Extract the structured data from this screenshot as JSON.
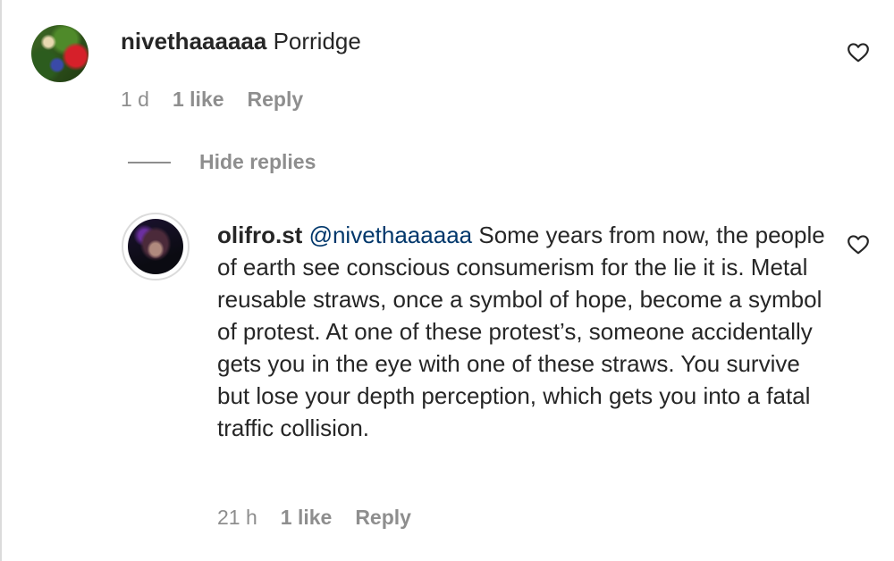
{
  "comment": {
    "username": "nivethaaaaaa",
    "text": "Porridge",
    "time": "1 d",
    "likes": "1 like",
    "reply_label": "Reply",
    "heart_icon": "heart-outline-icon"
  },
  "hide_replies_label": "Hide replies",
  "reply": {
    "username": "olifro.st",
    "mention": "@nivethaaaaaa",
    "text": "Some years from now, the people of earth see conscious consumerism for the lie it is. Metal reusable straws, once a symbol of hope, become a symbol of protest. At one of these protest’s, someone accidentally gets you in the eye with one of these straws. You survive but lose your depth perception, which gets you into a fatal traffic collision.",
    "time": "21 h",
    "likes": "1 like",
    "reply_label": "Reply",
    "heart_icon": "heart-outline-icon"
  },
  "colors": {
    "text": "#262626",
    "secondary": "#8e8e8e",
    "mention": "#00376b",
    "border": "#dbdbdb"
  }
}
